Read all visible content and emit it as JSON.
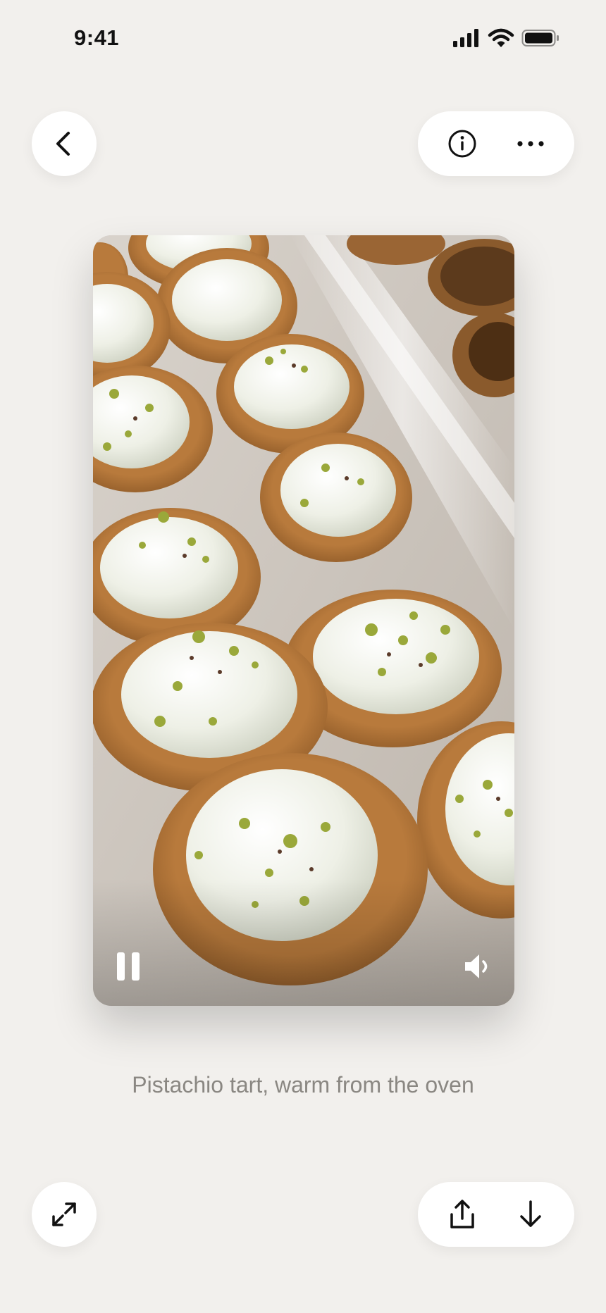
{
  "status_bar": {
    "time": "9:41"
  },
  "media": {
    "caption": "Pistachio tart, warm from the oven",
    "playback_state": "playing",
    "sound": "on"
  },
  "icons": {
    "back": "chevron-left-icon",
    "info": "info-icon",
    "more": "more-horizontal-icon",
    "pause": "pause-icon",
    "volume": "volume-icon",
    "expand": "expand-icon",
    "share": "share-icon",
    "download": "download-icon"
  },
  "colors": {
    "background": "#f2f0ed",
    "button_surface": "#ffffff",
    "caption_text": "#8a8782",
    "icon": "#111111"
  }
}
